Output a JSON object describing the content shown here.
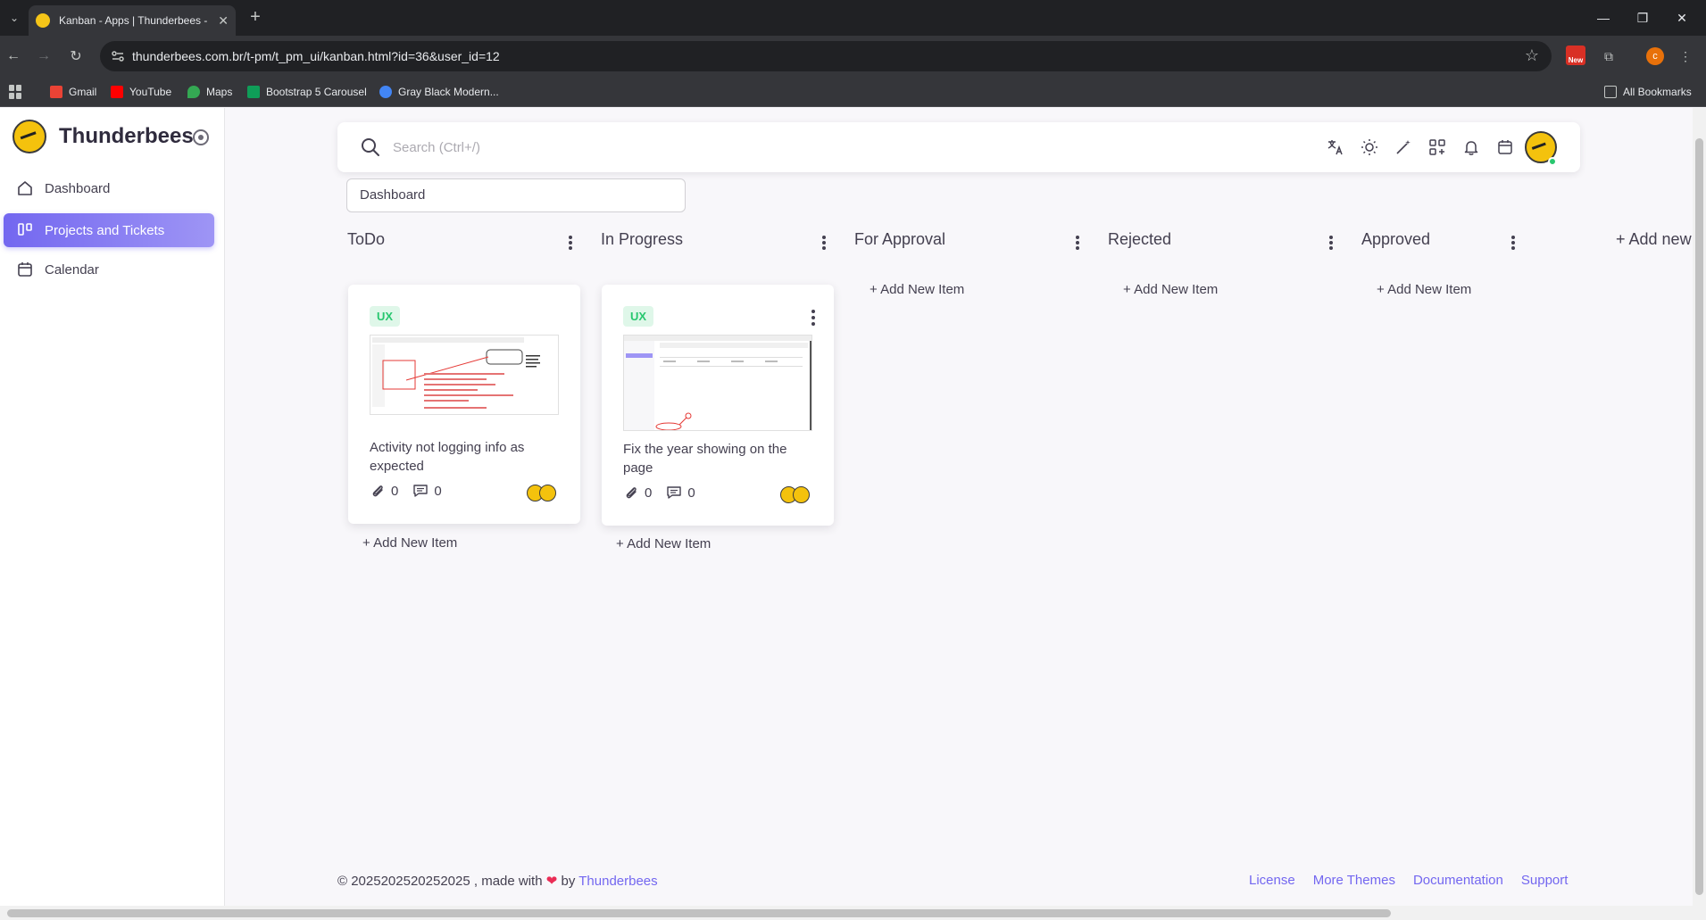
{
  "browser": {
    "tab_title": "Kanban - Apps | Thunderbees -",
    "url": "thunderbees.com.br/t-pm/t_pm_ui/kanban.html?id=36&user_id=12",
    "ext_new_label": "New",
    "profile_initial": "c",
    "bookmarks": [
      {
        "label": "Gmail",
        "color": "#ea4335"
      },
      {
        "label": "YouTube",
        "color": "#ff0000"
      },
      {
        "label": "Maps",
        "color": "#34a853"
      },
      {
        "label": "Bootstrap 5 Carousel",
        "color": "#0f9d58"
      },
      {
        "label": "Gray Black Modern...",
        "color": "#4285f4"
      }
    ],
    "all_bookmarks": "All Bookmarks"
  },
  "sidebar": {
    "brand": "Thunderbees",
    "items": [
      {
        "label": "Dashboard",
        "icon": "home-icon",
        "active": false
      },
      {
        "label": "Projects and Tickets",
        "icon": "kanban-icon",
        "active": true
      },
      {
        "label": "Calendar",
        "icon": "calendar-icon",
        "active": false
      }
    ]
  },
  "topbar": {
    "search_placeholder": "Search (Ctrl+/)",
    "icons": [
      "translate-icon",
      "theme-sun-icon",
      "magic-wand-icon",
      "shortcuts-icon",
      "notifications-bell-icon",
      "calendar-icon"
    ]
  },
  "board": {
    "title_value": "Dashboard",
    "add_board_label": "+ Add new",
    "add_item_label": "+ Add New Item",
    "columns": [
      {
        "title": "ToDo",
        "cards": [
          {
            "badge": "UX",
            "title": "Activity not logging info as expected",
            "attachments": "0",
            "comments": "0"
          }
        ]
      },
      {
        "title": "In Progress",
        "cards": [
          {
            "badge": "UX",
            "title": "Fix the year showing on the page",
            "attachments": "0",
            "comments": "0"
          }
        ]
      },
      {
        "title": "For Approval",
        "cards": []
      },
      {
        "title": "Rejected",
        "cards": []
      },
      {
        "title": "Approved",
        "cards": []
      }
    ]
  },
  "footer": {
    "copyright": "© 2025202520252025 , made with",
    "by": "by",
    "brand_link": "Thunderbees",
    "links": [
      "License",
      "More Themes",
      "Documentation",
      "Support"
    ],
    "heart_color": "#ea2c55"
  },
  "colors": {
    "primary": "#7367f0",
    "success": "#28c76f",
    "badge_bg": "#dff7e9"
  }
}
